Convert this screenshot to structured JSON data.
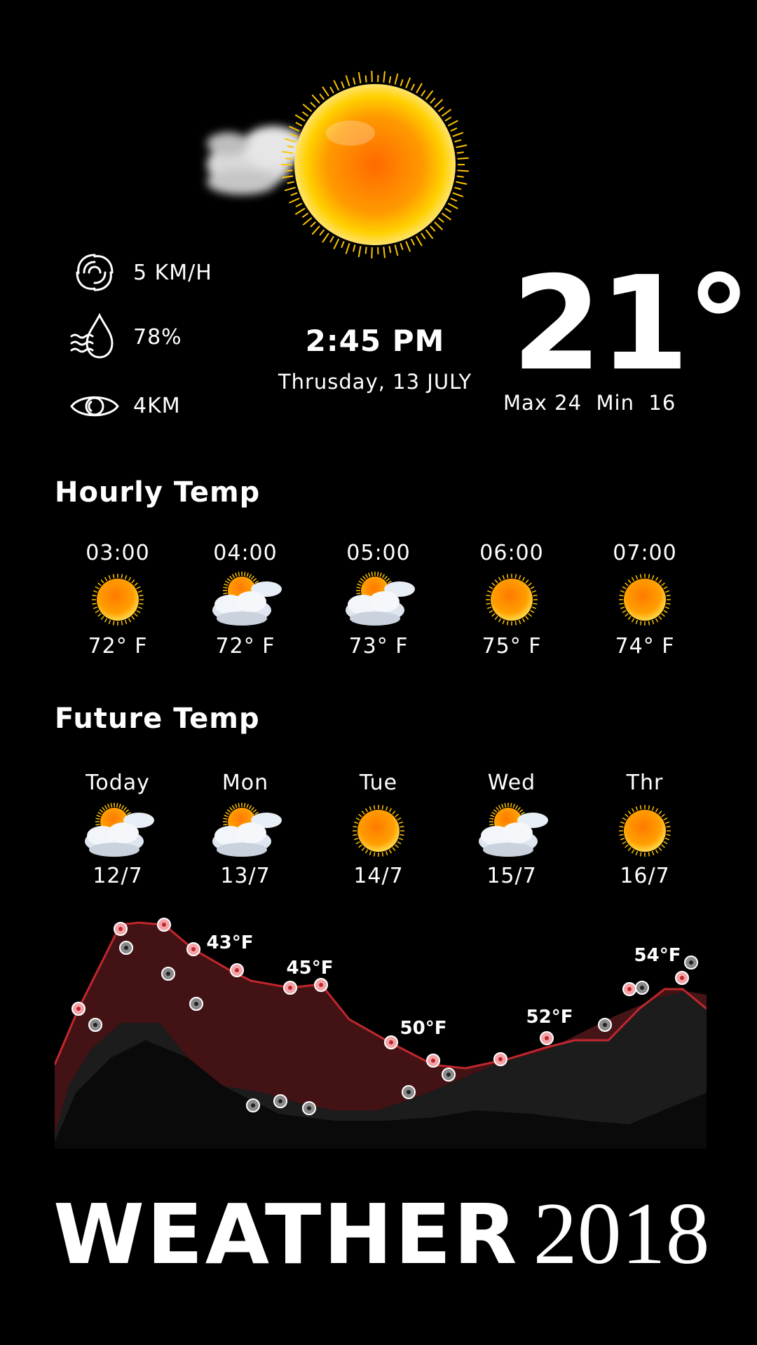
{
  "current": {
    "icon": "sun-with-cloud-icon",
    "wind": "5 KM/H",
    "humidity": "78%",
    "visibility": "4KM",
    "time": "2:45 PM",
    "date": "Thrusday, 13 JULY",
    "temperature": "21°",
    "max_min": "Max 24  Min  16"
  },
  "hourly": {
    "title": "Hourly Temp",
    "items": [
      {
        "time": "03:00",
        "icon": "sun-icon",
        "temp": "72° F"
      },
      {
        "time": "04:00",
        "icon": "partly-cloudy-icon",
        "temp": "72° F"
      },
      {
        "time": "05:00",
        "icon": "partly-cloudy-icon",
        "temp": "73° F"
      },
      {
        "time": "06:00",
        "icon": "sun-icon",
        "temp": "75° F"
      },
      {
        "time": "07:00",
        "icon": "sun-icon",
        "temp": "74° F"
      }
    ]
  },
  "future": {
    "title": "Future Temp",
    "items": [
      {
        "day": "Today",
        "icon": "partly-cloudy-icon",
        "date": "12/7"
      },
      {
        "day": "Mon",
        "icon": "partly-cloudy-icon",
        "date": "13/7"
      },
      {
        "day": "Tue",
        "icon": "sun-icon",
        "date": "14/7"
      },
      {
        "day": "Wed",
        "icon": "partly-cloudy-icon",
        "date": "15/7"
      },
      {
        "day": "Thr",
        "icon": "sun-icon",
        "date": "16/7"
      }
    ]
  },
  "chart_data": {
    "type": "area",
    "labels": [
      "43°F",
      "45°F",
      "50°F",
      "52°F",
      "54°F"
    ],
    "colors": {
      "upper_line": "#c0272d",
      "upper_fill": "#4a1417",
      "lower_fill": "#1c1c1c",
      "dots_upper": "#f2a4a8",
      "dots_lower": "#8a8a8a"
    }
  },
  "brand": {
    "word": "WEATHER",
    "year": "2018"
  }
}
